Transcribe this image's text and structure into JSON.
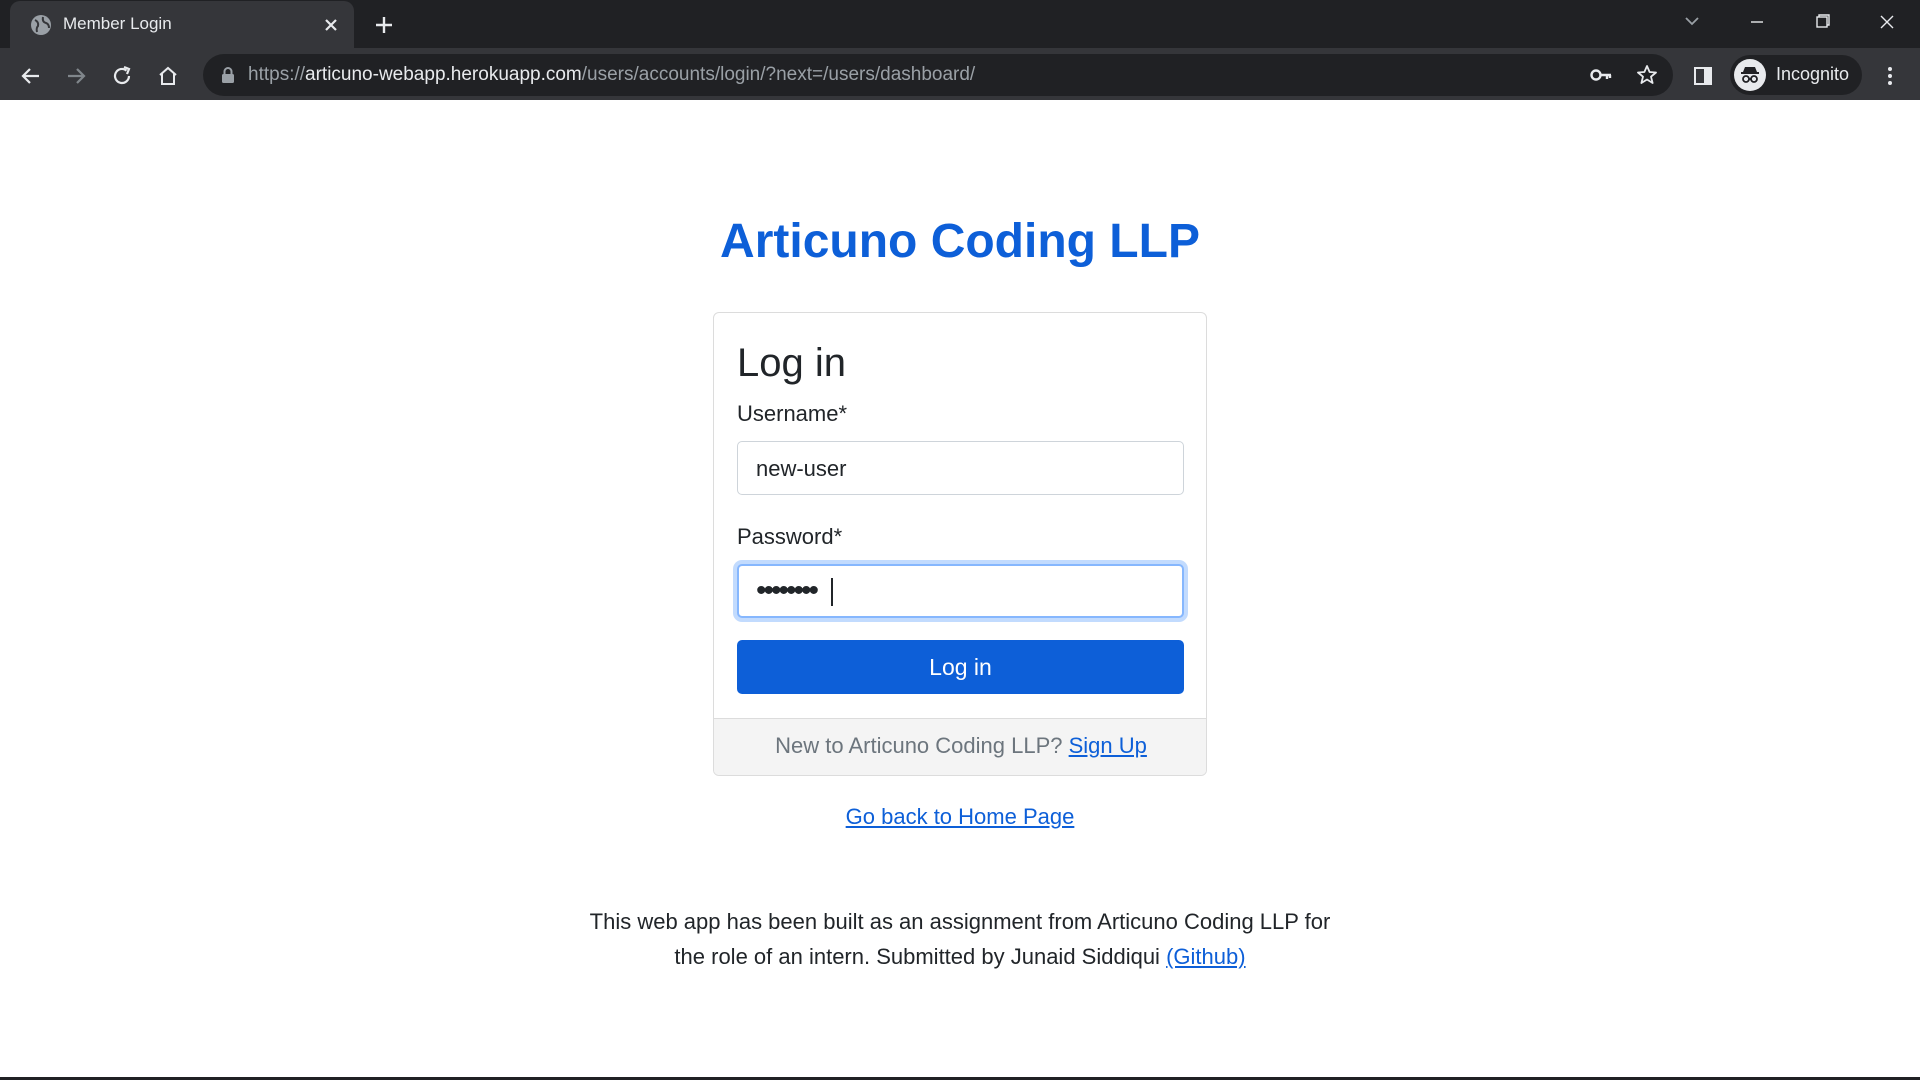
{
  "browser": {
    "tab_title": "Member Login",
    "url_prefix": "https://",
    "url_host": "articuno-webapp.herokuapp.com",
    "url_path": "/users/accounts/login/?next=/users/dashboard/",
    "profile_label": "Incognito"
  },
  "page": {
    "brand": "Articuno Coding LLP",
    "card_title": "Log in",
    "username_label": "Username*",
    "username_value": "new-user",
    "password_label": "Password*",
    "password_masked": "••••••••",
    "login_button": "Log in",
    "signup_prompt": "New to Articuno Coding LLP?",
    "signup_link": "Sign Up",
    "home_link": "Go back to Home Page",
    "footer_line1": "This web app has been built as an assignment from Articuno Coding LLP for",
    "footer_line2": "the role of an intern. Submitted by Junaid Siddiqui",
    "github_link": "(Github)"
  },
  "colors": {
    "brand_blue": "#0d5fd8",
    "chrome_dark": "#202124",
    "chrome_toolbar": "#35363a"
  }
}
